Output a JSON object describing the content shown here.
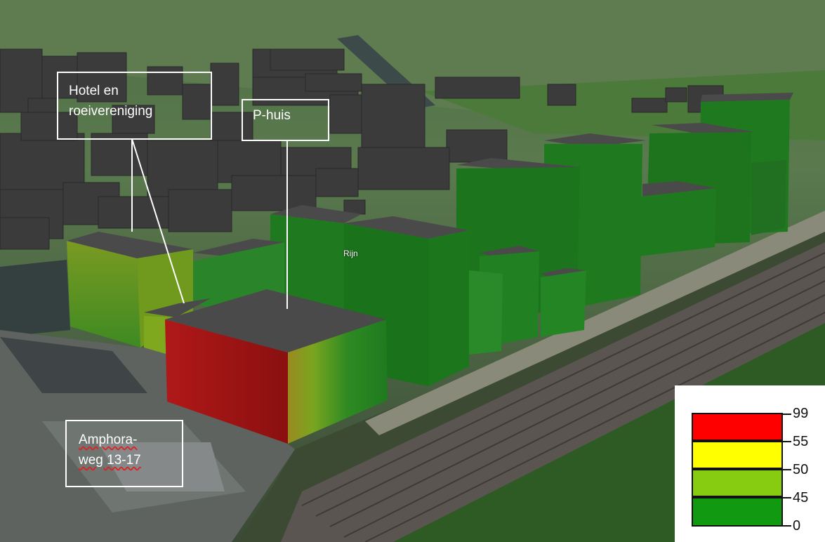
{
  "callouts": {
    "hotel": "Hotel en\nroeivereniging",
    "phuis": "P-huis",
    "amphora": "Amphora-\nweg 13-17"
  },
  "place_label": "Rijn",
  "legend": {
    "classes": [
      {
        "from": 55,
        "to": 99,
        "color": "#ff0000"
      },
      {
        "from": 50,
        "to": 55,
        "color": "#ffff00"
      },
      {
        "from": 45,
        "to": 50,
        "color": "#88cc11"
      },
      {
        "from": 0,
        "to": 45,
        "color": "#119911"
      }
    ],
    "labels": [
      "99",
      "55",
      "50",
      "45",
      "0"
    ]
  },
  "colors": {
    "building_green": "#1f7a1f",
    "building_yellowgreen": "#7aa520",
    "building_red": "#a51a1a",
    "roof": "#4a4a4a",
    "context_buildings": "#3b3b3b"
  }
}
